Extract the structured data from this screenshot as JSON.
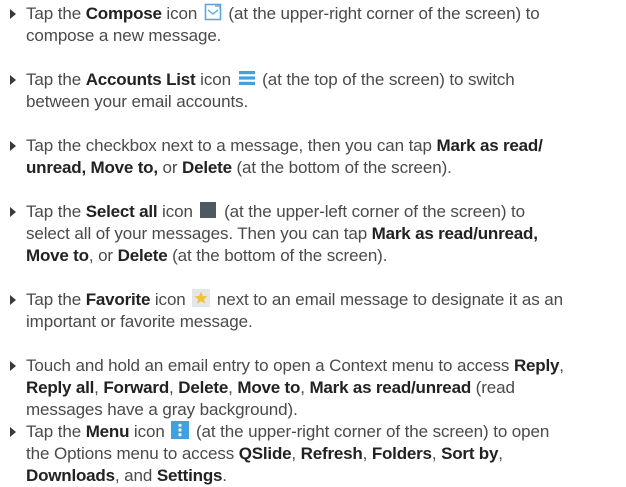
{
  "bullets": [
    {
      "lines": [
        [
          [
            "t",
            "Tap the "
          ],
          [
            "b",
            "Compose"
          ],
          [
            "t",
            " icon "
          ],
          [
            "i",
            "compose-icon"
          ],
          [
            "t",
            " (at the upper-right corner of the screen) to"
          ]
        ],
        [
          [
            "t",
            "compose a new message."
          ]
        ]
      ]
    },
    {
      "lines": [
        [
          [
            "t",
            "Tap the "
          ],
          [
            "b",
            "Accounts List"
          ],
          [
            "t",
            " icon "
          ],
          [
            "i",
            "accounts-list-icon"
          ],
          [
            "t",
            " (at the top of the screen) to switch"
          ]
        ],
        [
          [
            "t",
            "between your email accounts."
          ]
        ]
      ]
    },
    {
      "lines": [
        [
          [
            "t",
            "Tap the checkbox next to a message, then you can tap "
          ],
          [
            "b",
            "Mark as read/"
          ]
        ],
        [
          [
            "b",
            "unread, Move to,"
          ],
          [
            "t",
            " or "
          ],
          [
            "b",
            "Delete"
          ],
          [
            "t",
            " (at the bottom of the screen)."
          ]
        ]
      ]
    },
    {
      "lines": [
        [
          [
            "t",
            "Tap the "
          ],
          [
            "b",
            "Select all"
          ],
          [
            "t",
            " icon "
          ],
          [
            "i",
            "select-all-icon"
          ],
          [
            "t",
            " (at the upper-left corner of the screen) to"
          ]
        ],
        [
          [
            "t",
            "select all of your messages. Then you can tap "
          ],
          [
            "b",
            "Mark as read/unread,"
          ]
        ],
        [
          [
            "b",
            "Move to"
          ],
          [
            "t",
            ", or "
          ],
          [
            "b",
            "Delete"
          ],
          [
            "t",
            " (at the bottom of the screen)."
          ]
        ]
      ]
    },
    {
      "lines": [
        [
          [
            "t",
            "Tap the "
          ],
          [
            "b",
            "Favorite"
          ],
          [
            "t",
            " icon "
          ],
          [
            "i",
            "favorite-star-icon"
          ],
          [
            "t",
            " next to an email message to designate it as an"
          ]
        ],
        [
          [
            "t",
            "important or favorite message."
          ]
        ]
      ]
    },
    {
      "lines": [
        [
          [
            "t",
            "Touch and hold an email entry to open a Context menu to access "
          ],
          [
            "b",
            "Reply"
          ],
          [
            "t",
            ","
          ]
        ],
        [
          [
            "b",
            "Reply all"
          ],
          [
            "t",
            ", "
          ],
          [
            "b",
            "Forward"
          ],
          [
            "t",
            ", "
          ],
          [
            "b",
            "Delete"
          ],
          [
            "t",
            ", "
          ],
          [
            "b",
            "Move to"
          ],
          [
            "t",
            ", "
          ],
          [
            "b",
            "Mark as read/unread"
          ],
          [
            "t",
            " (read"
          ]
        ],
        [
          [
            "t",
            "messages have a gray background)."
          ]
        ]
      ]
    },
    {
      "lines": [
        [
          [
            "t",
            "Tap the "
          ],
          [
            "b",
            "Menu"
          ],
          [
            "t",
            " icon "
          ],
          [
            "i",
            "menu-icon"
          ],
          [
            "t",
            " (at the upper-right corner of the screen) to open"
          ]
        ],
        [
          [
            "t",
            "the Options menu to access "
          ],
          [
            "b",
            "QSlide"
          ],
          [
            "t",
            ", "
          ],
          [
            "b",
            "Refresh"
          ],
          [
            "t",
            ", "
          ],
          [
            "b",
            "Folders"
          ],
          [
            "t",
            ", "
          ],
          [
            "b",
            "Sort by"
          ],
          [
            "t",
            ","
          ]
        ],
        [
          [
            "b",
            "Downloads"
          ],
          [
            "t",
            ", and "
          ],
          [
            "b",
            "Settings"
          ],
          [
            "t",
            "."
          ]
        ]
      ]
    }
  ]
}
